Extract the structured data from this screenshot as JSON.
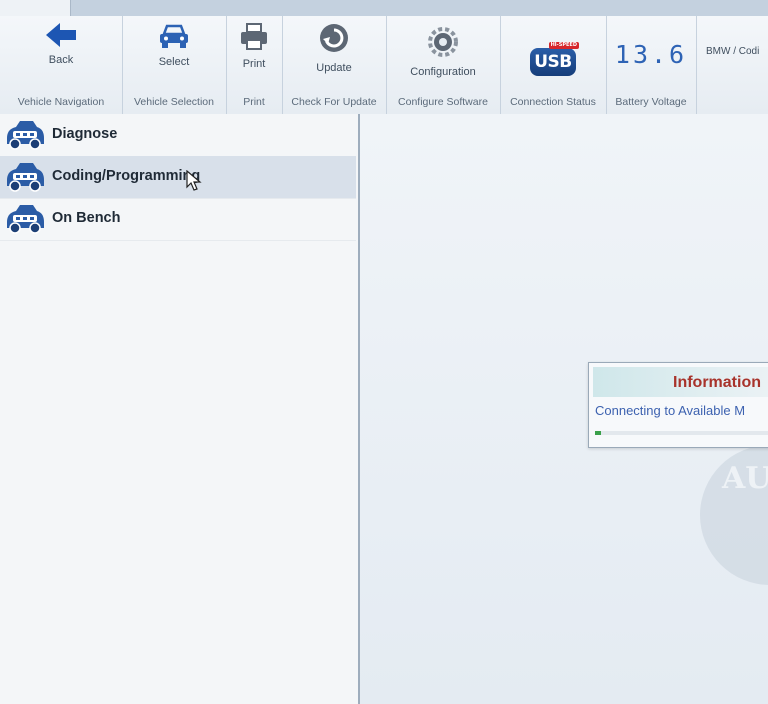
{
  "toolbar": {
    "back_label": "Back",
    "vehicle_navigation_label": "Vehicle Navigation",
    "select_label": "Select",
    "vehicle_selection_label": "Vehicle Selection",
    "print_label": "Print",
    "print_group_label": "Print",
    "update_label": "Update",
    "check_for_update_label": "Check For Update",
    "configuration_label": "Configuration",
    "configure_software_label": "Configure Software",
    "usb_badge": "USB",
    "usb_badge_sub": "HI-SPEED",
    "connection_status_label": "Connection Status",
    "battery_voltage_value": "13.6",
    "battery_voltage_label": "Battery Voltage",
    "breadcrumb": "BMW / Codi"
  },
  "nav": {
    "items": [
      {
        "label": "Diagnose",
        "selected": false
      },
      {
        "label": "Coding/Programming",
        "selected": true
      },
      {
        "label": "On Bench",
        "selected": false
      }
    ]
  },
  "dialog": {
    "title": "Information",
    "message": "Connecting to Available M",
    "progress": 0.03
  },
  "watermark_text": "AU",
  "colors": {
    "accent_blue": "#2e63b5",
    "dialog_title": "#a8332b",
    "progress": "#3aa04a"
  },
  "icons": {
    "back": "arrow-left-icon",
    "select": "car-front-icon",
    "print": "printer-icon",
    "update": "refresh-icon",
    "configuration": "gear-icon",
    "nav_items": "obd-car-icon"
  }
}
